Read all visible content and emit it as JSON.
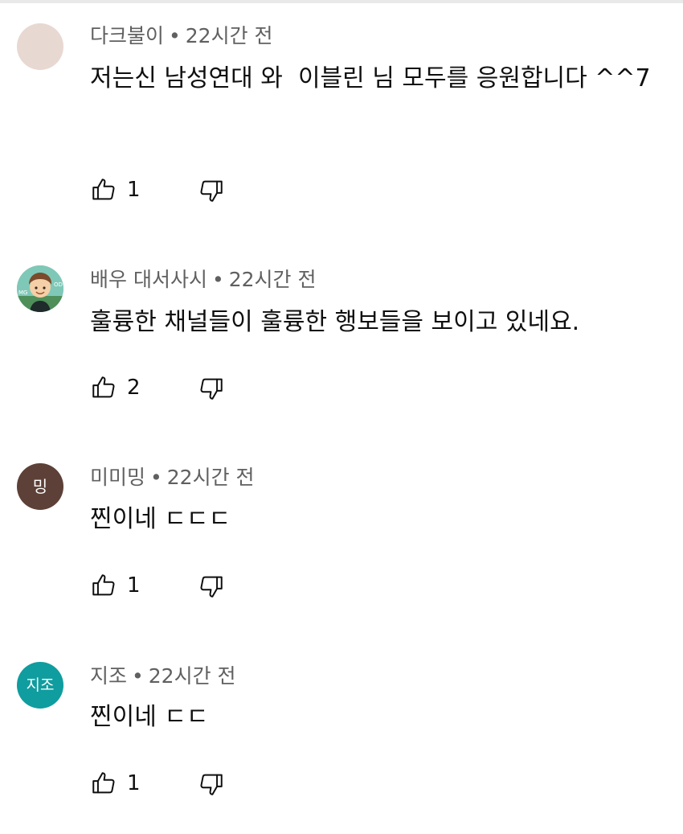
{
  "comments": [
    {
      "author": "다크불이",
      "separator": "•",
      "time": "22시간 전",
      "text": "저는신 남성연대 와  이블린 님 모두를 응원합니다 ^^7",
      "likes": "1",
      "avatar": {
        "type": "blank",
        "color": "#e8d8d2",
        "letter": ""
      },
      "icons": {
        "like": "thumbs-up-icon",
        "dislike": "thumbs-down-icon"
      }
    },
    {
      "author": "배우 대서사시",
      "separator": "•",
      "time": "22시간 전",
      "text": "훌륭한 채널들이 훌륭한 행보들을 보이고 있네요.",
      "likes": "2",
      "avatar": {
        "type": "illustration",
        "color": "#7fc8b8",
        "letter": ""
      },
      "icons": {
        "like": "thumbs-up-icon",
        "dislike": "thumbs-down-icon"
      }
    },
    {
      "author": "미미밍",
      "separator": "•",
      "time": "22시간 전",
      "text": "찐이네 ㄷㄷㄷ",
      "likes": "1",
      "avatar": {
        "type": "letter",
        "color": "#5d4037",
        "letter": "밍"
      },
      "icons": {
        "like": "thumbs-up-icon",
        "dislike": "thumbs-down-icon"
      }
    },
    {
      "author": "지조",
      "separator": "•",
      "time": "22시간 전",
      "text": "찐이네 ㄷㄷ",
      "likes": "1",
      "avatar": {
        "type": "letter",
        "color": "#0f9d9f",
        "letter": "지조"
      },
      "icons": {
        "like": "thumbs-up-icon",
        "dislike": "thumbs-down-icon"
      }
    }
  ]
}
